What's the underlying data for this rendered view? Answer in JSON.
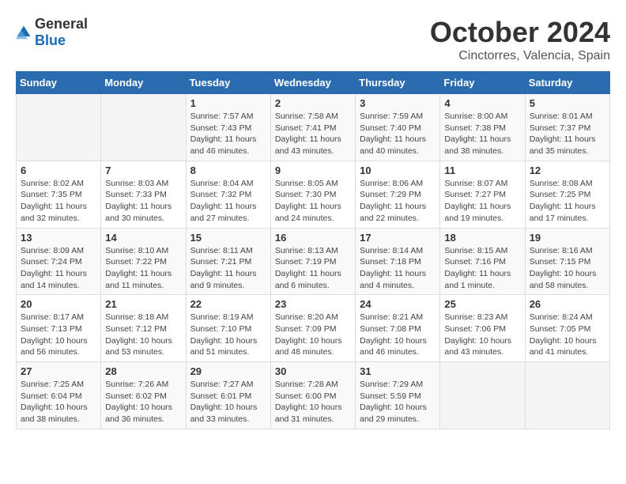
{
  "header": {
    "logo": {
      "general": "General",
      "blue": "Blue"
    },
    "month": "October 2024",
    "location": "Cinctorres, Valencia, Spain"
  },
  "days_of_week": [
    "Sunday",
    "Monday",
    "Tuesday",
    "Wednesday",
    "Thursday",
    "Friday",
    "Saturday"
  ],
  "weeks": [
    [
      {
        "day": "",
        "info": ""
      },
      {
        "day": "",
        "info": ""
      },
      {
        "day": "1",
        "info": "Sunrise: 7:57 AM\nSunset: 7:43 PM\nDaylight: 11 hours and 46 minutes."
      },
      {
        "day": "2",
        "info": "Sunrise: 7:58 AM\nSunset: 7:41 PM\nDaylight: 11 hours and 43 minutes."
      },
      {
        "day": "3",
        "info": "Sunrise: 7:59 AM\nSunset: 7:40 PM\nDaylight: 11 hours and 40 minutes."
      },
      {
        "day": "4",
        "info": "Sunrise: 8:00 AM\nSunset: 7:38 PM\nDaylight: 11 hours and 38 minutes."
      },
      {
        "day": "5",
        "info": "Sunrise: 8:01 AM\nSunset: 7:37 PM\nDaylight: 11 hours and 35 minutes."
      }
    ],
    [
      {
        "day": "6",
        "info": "Sunrise: 8:02 AM\nSunset: 7:35 PM\nDaylight: 11 hours and 32 minutes."
      },
      {
        "day": "7",
        "info": "Sunrise: 8:03 AM\nSunset: 7:33 PM\nDaylight: 11 hours and 30 minutes."
      },
      {
        "day": "8",
        "info": "Sunrise: 8:04 AM\nSunset: 7:32 PM\nDaylight: 11 hours and 27 minutes."
      },
      {
        "day": "9",
        "info": "Sunrise: 8:05 AM\nSunset: 7:30 PM\nDaylight: 11 hours and 24 minutes."
      },
      {
        "day": "10",
        "info": "Sunrise: 8:06 AM\nSunset: 7:29 PM\nDaylight: 11 hours and 22 minutes."
      },
      {
        "day": "11",
        "info": "Sunrise: 8:07 AM\nSunset: 7:27 PM\nDaylight: 11 hours and 19 minutes."
      },
      {
        "day": "12",
        "info": "Sunrise: 8:08 AM\nSunset: 7:25 PM\nDaylight: 11 hours and 17 minutes."
      }
    ],
    [
      {
        "day": "13",
        "info": "Sunrise: 8:09 AM\nSunset: 7:24 PM\nDaylight: 11 hours and 14 minutes."
      },
      {
        "day": "14",
        "info": "Sunrise: 8:10 AM\nSunset: 7:22 PM\nDaylight: 11 hours and 11 minutes."
      },
      {
        "day": "15",
        "info": "Sunrise: 8:11 AM\nSunset: 7:21 PM\nDaylight: 11 hours and 9 minutes."
      },
      {
        "day": "16",
        "info": "Sunrise: 8:13 AM\nSunset: 7:19 PM\nDaylight: 11 hours and 6 minutes."
      },
      {
        "day": "17",
        "info": "Sunrise: 8:14 AM\nSunset: 7:18 PM\nDaylight: 11 hours and 4 minutes."
      },
      {
        "day": "18",
        "info": "Sunrise: 8:15 AM\nSunset: 7:16 PM\nDaylight: 11 hours and 1 minute."
      },
      {
        "day": "19",
        "info": "Sunrise: 8:16 AM\nSunset: 7:15 PM\nDaylight: 10 hours and 58 minutes."
      }
    ],
    [
      {
        "day": "20",
        "info": "Sunrise: 8:17 AM\nSunset: 7:13 PM\nDaylight: 10 hours and 56 minutes."
      },
      {
        "day": "21",
        "info": "Sunrise: 8:18 AM\nSunset: 7:12 PM\nDaylight: 10 hours and 53 minutes."
      },
      {
        "day": "22",
        "info": "Sunrise: 8:19 AM\nSunset: 7:10 PM\nDaylight: 10 hours and 51 minutes."
      },
      {
        "day": "23",
        "info": "Sunrise: 8:20 AM\nSunset: 7:09 PM\nDaylight: 10 hours and 48 minutes."
      },
      {
        "day": "24",
        "info": "Sunrise: 8:21 AM\nSunset: 7:08 PM\nDaylight: 10 hours and 46 minutes."
      },
      {
        "day": "25",
        "info": "Sunrise: 8:23 AM\nSunset: 7:06 PM\nDaylight: 10 hours and 43 minutes."
      },
      {
        "day": "26",
        "info": "Sunrise: 8:24 AM\nSunset: 7:05 PM\nDaylight: 10 hours and 41 minutes."
      }
    ],
    [
      {
        "day": "27",
        "info": "Sunrise: 7:25 AM\nSunset: 6:04 PM\nDaylight: 10 hours and 38 minutes."
      },
      {
        "day": "28",
        "info": "Sunrise: 7:26 AM\nSunset: 6:02 PM\nDaylight: 10 hours and 36 minutes."
      },
      {
        "day": "29",
        "info": "Sunrise: 7:27 AM\nSunset: 6:01 PM\nDaylight: 10 hours and 33 minutes."
      },
      {
        "day": "30",
        "info": "Sunrise: 7:28 AM\nSunset: 6:00 PM\nDaylight: 10 hours and 31 minutes."
      },
      {
        "day": "31",
        "info": "Sunrise: 7:29 AM\nSunset: 5:59 PM\nDaylight: 10 hours and 29 minutes."
      },
      {
        "day": "",
        "info": ""
      },
      {
        "day": "",
        "info": ""
      }
    ]
  ]
}
